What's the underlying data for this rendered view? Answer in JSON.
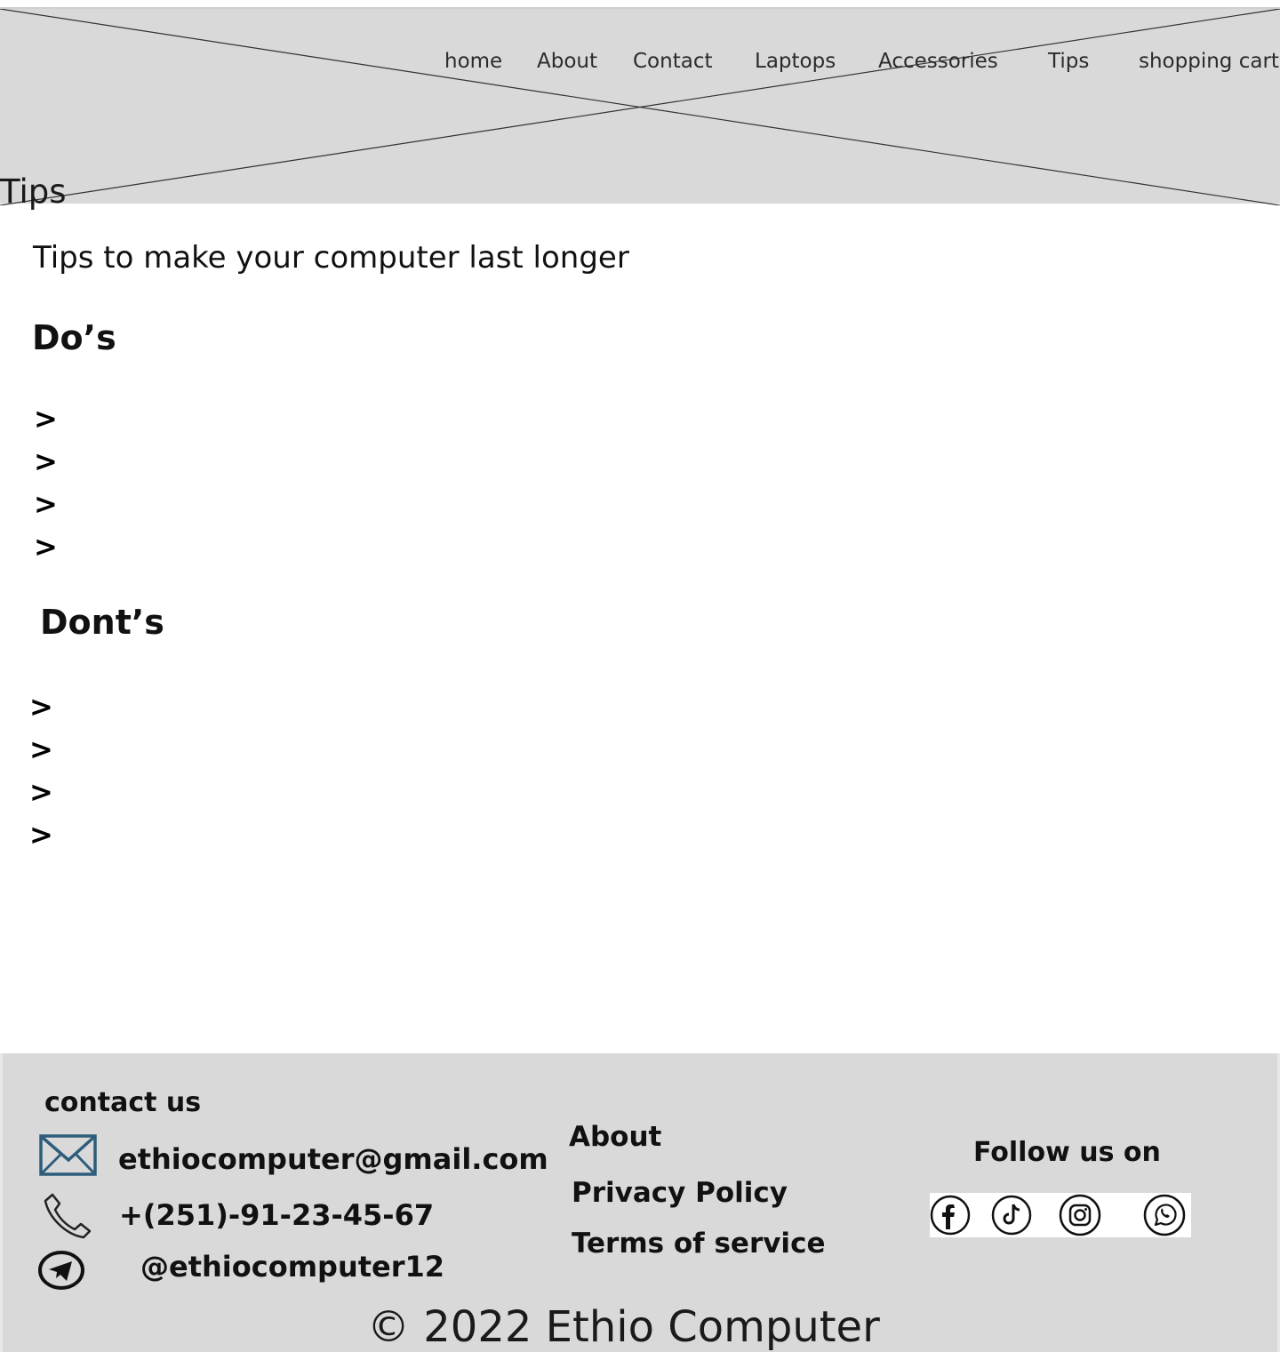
{
  "nav": {
    "items": [
      "home",
      "About",
      "Contact",
      "Laptops",
      "Accessories",
      "Tips",
      "shopping cart"
    ]
  },
  "header": {
    "page_label": "Tips"
  },
  "main": {
    "subtitle": "Tips to make your computer last longer",
    "dos": {
      "heading": "Do’s",
      "bullets": [
        ">",
        ">",
        ">",
        ">"
      ]
    },
    "donts": {
      "heading": "Dont’s",
      "bullets": [
        ">",
        ">",
        ">",
        ">"
      ]
    }
  },
  "footer": {
    "contact_heading": "contact us",
    "email": "ethiocomputer@gmail.com",
    "phone": "+(251)-91-23-45-67",
    "telegram": "@ethiocomputer12",
    "links": {
      "about": "About",
      "privacy": "Privacy Policy",
      "terms": "Terms of service"
    },
    "follow_heading": "Follow us on",
    "social_icons": [
      "facebook-icon",
      "tiktok-icon",
      "instagram-icon",
      "whatsapp-icon"
    ],
    "copyright": "© 2022 Ethio Computer"
  },
  "colors": {
    "placeholder_gray": "#d9d9d9",
    "text": "#111111",
    "email_icon": "#2d5d7b"
  }
}
